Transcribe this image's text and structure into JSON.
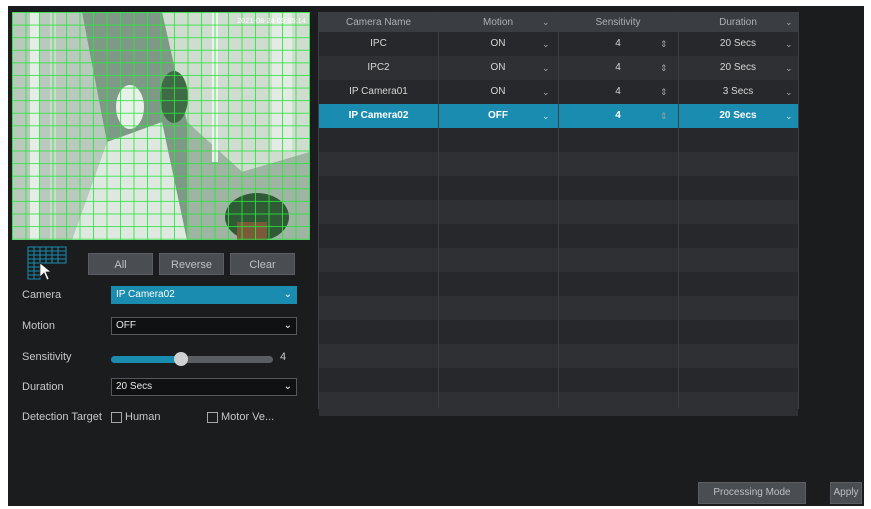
{
  "preview": {
    "timestamp": "2021-08-24 09:05:14"
  },
  "area_buttons": {
    "all": "All",
    "reverse": "Reverse",
    "clear": "Clear"
  },
  "form": {
    "camera_label": "Camera",
    "camera_value": "IP Camera02",
    "motion_label": "Motion",
    "motion_value": "OFF",
    "sensitivity_label": "Sensitivity",
    "sensitivity_value": "4",
    "sensitivity_fraction": 0.43,
    "duration_label": "Duration",
    "duration_value": "20 Secs",
    "detection_target_label": "Detection Target",
    "human_label": "Human",
    "motor_label": "Motor Ve..."
  },
  "table": {
    "headers": [
      "Camera Name",
      "Motion",
      "Sensitivity",
      "Duration"
    ],
    "rows": [
      {
        "name": "IPC",
        "motion": "ON",
        "sensitivity": "4",
        "duration": "20 Secs",
        "selected": false
      },
      {
        "name": "IPC2",
        "motion": "ON",
        "sensitivity": "4",
        "duration": "20 Secs",
        "selected": false
      },
      {
        "name": "IP Camera01",
        "motion": "ON",
        "sensitivity": "4",
        "duration": "3 Secs",
        "selected": false
      },
      {
        "name": "IP Camera02",
        "motion": "OFF",
        "sensitivity": "4",
        "duration": "20 Secs",
        "selected": true
      }
    ]
  },
  "footer": {
    "processing_mode": "Processing Mode",
    "apply": "Apply"
  },
  "colors": {
    "accent": "#1a8cb0",
    "grid": "#28e63c",
    "background": "#1b1c1e"
  }
}
